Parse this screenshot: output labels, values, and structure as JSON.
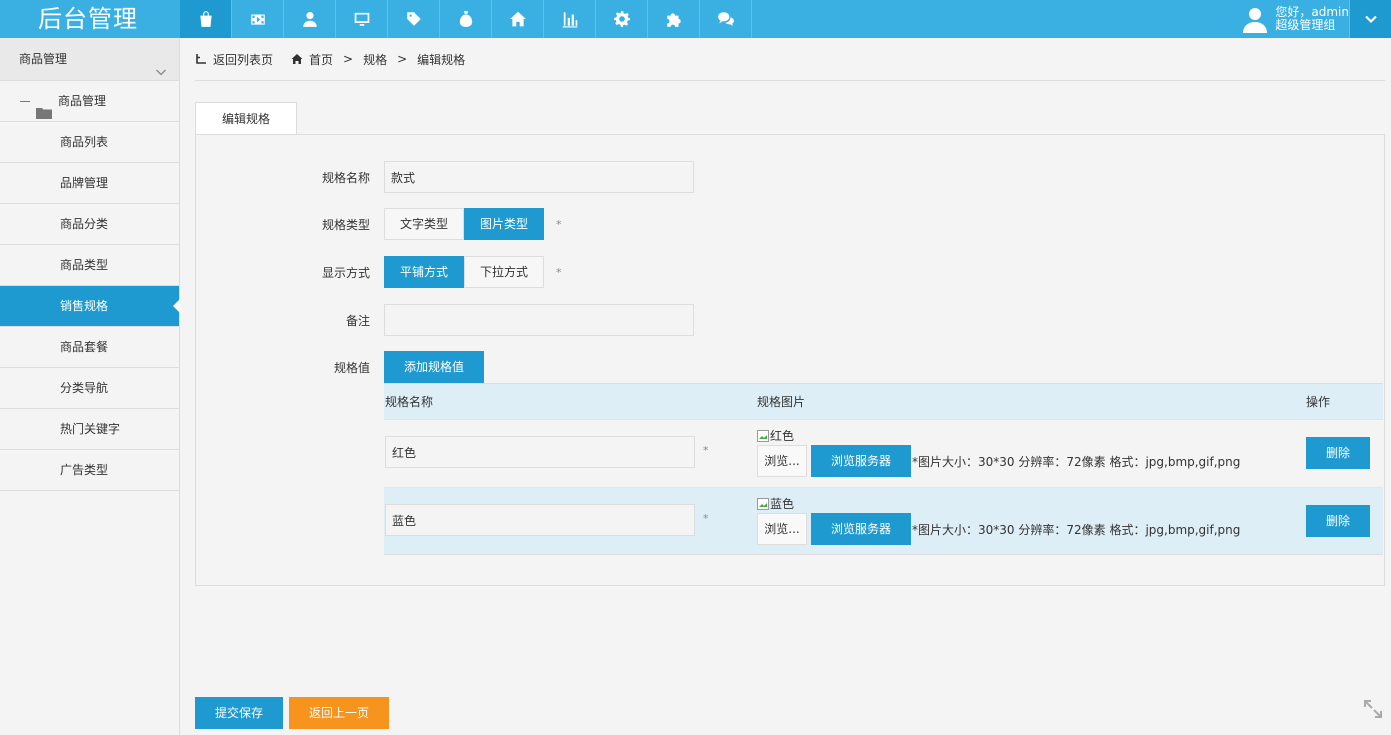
{
  "header": {
    "brand": "后台管理",
    "nav_icons": [
      "bag-icon",
      "film-icon",
      "user-icon",
      "monitor-icon",
      "tag-icon",
      "money-bag-icon",
      "home-icon",
      "bar-chart-icon",
      "gear-icon",
      "puzzle-icon",
      "chat-icon"
    ],
    "user_greeting": "您好，admin",
    "user_role": "超级管理组"
  },
  "sidebar": {
    "section_title": "商品管理",
    "group_title": "商品管理",
    "items": [
      "商品列表",
      "品牌管理",
      "商品分类",
      "商品类型",
      "销售规格",
      "商品套餐",
      "分类导航",
      "热门关键字",
      "广告类型"
    ],
    "active_index": 4
  },
  "breadcrumb": {
    "back": "返回列表页",
    "home": "首页",
    "level1": "规格",
    "level2": "编辑规格",
    "separator": ">"
  },
  "tab": {
    "label": "编辑规格"
  },
  "form": {
    "name_label": "规格名称",
    "name_value": "款式",
    "type_label": "规格类型",
    "type_options": [
      "文字类型",
      "图片类型"
    ],
    "type_selected": 1,
    "display_label": "显示方式",
    "display_options": [
      "平铺方式",
      "下拉方式"
    ],
    "display_selected": 0,
    "required_mark": "*",
    "remark_label": "备注",
    "remark_value": "",
    "values_label": "规格值",
    "add_value_button": "添加规格值"
  },
  "table": {
    "headers": [
      "规格名称",
      "规格图片",
      "操作"
    ],
    "rows": [
      {
        "name": "红色",
        "image_alt": "红色",
        "browse_local": "浏览...",
        "browse_server": "浏览服务器",
        "hint": "*图片大小：30*30 分辨率：72像素 格式：jpg,bmp,gif,png",
        "delete": "删除"
      },
      {
        "name": "蓝色",
        "image_alt": "蓝色",
        "browse_local": "浏览...",
        "browse_server": "浏览服务器",
        "hint": "*图片大小：30*30 分辨率：72像素 格式：jpg,bmp,gif,png",
        "delete": "删除"
      }
    ]
  },
  "footer": {
    "save": "提交保存",
    "back": "返回上一页"
  },
  "colors": {
    "primary": "#1e9ad0",
    "header": "#3ab0e2",
    "orange": "#f7941d",
    "row_alt": "#deeef6"
  }
}
